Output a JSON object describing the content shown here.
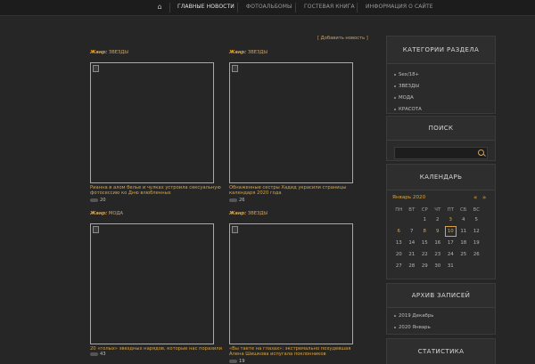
{
  "nav": {
    "home_icon": "home-icon",
    "items": [
      "ГЛАВНЫЕ НОВОСТИ",
      "ФОТОАЛЬБОМЫ",
      "ГОСТЕВАЯ КНИГА",
      "ИНФОРМАЦИЯ О САЙТЕ"
    ]
  },
  "content": {
    "add_news": "[ Добавить новость ]",
    "genre_label": "Жанр:",
    "cards": [
      {
        "genre": "ЗВЕЗДЫ",
        "caption": "Рианна в алом белье и чулках устроила сексуальную фотосессию ко Дню влюбленных",
        "views": "20"
      },
      {
        "genre": "ЗВЕЗДЫ",
        "caption": "Обнаженные сестры Хадид украсили страницы календаря 2020 года",
        "views": "26"
      },
      {
        "genre": "МОДА",
        "caption": "20 «голых» звездных нарядов, которые нас поразили",
        "views": "43"
      },
      {
        "genre": "ЗВЕЗДЫ",
        "caption": "«Вы таете на глазах»: экстремально похудевшая Алена Шишкова испугала поклонников",
        "views": "19"
      }
    ]
  },
  "sidebar": {
    "categories": {
      "title": "КАТЕГОРИИ РАЗДЕЛА",
      "items": [
        "Sex/18+",
        "ЗВЕЗДЫ",
        "МОДА",
        "КРАСОТА"
      ]
    },
    "search": {
      "title": "ПОИСК",
      "placeholder": ""
    },
    "calendar": {
      "title": "КАЛЕНДАРЬ",
      "month": "Январь 2020",
      "prev": "«",
      "next": "»",
      "days_of_week": [
        "ПН",
        "ВТ",
        "СР",
        "ЧТ",
        "ПТ",
        "СБ",
        "ВС"
      ],
      "weeks": [
        [
          "",
          "",
          "1",
          "2",
          "3",
          "4",
          "5"
        ],
        [
          "6",
          "7",
          "8",
          "9",
          "10",
          "11",
          "12"
        ],
        [
          "13",
          "14",
          "15",
          "16",
          "17",
          "18",
          "19"
        ],
        [
          "20",
          "21",
          "22",
          "23",
          "24",
          "25",
          "26"
        ],
        [
          "27",
          "28",
          "29",
          "30",
          "31",
          "",
          ""
        ]
      ],
      "linked_days": [
        "3",
        "6",
        "8",
        "9"
      ],
      "today": "10"
    },
    "archive": {
      "title": "АРХИВ ЗАПИСЕЙ",
      "items": [
        "2019 Декабрь",
        "2020 Январь"
      ]
    },
    "stats": {
      "title": "СТАТИСТИКА"
    }
  },
  "colors": {
    "accent": "#d9a441",
    "background": "#262626",
    "widget": "#2b2b2b"
  }
}
